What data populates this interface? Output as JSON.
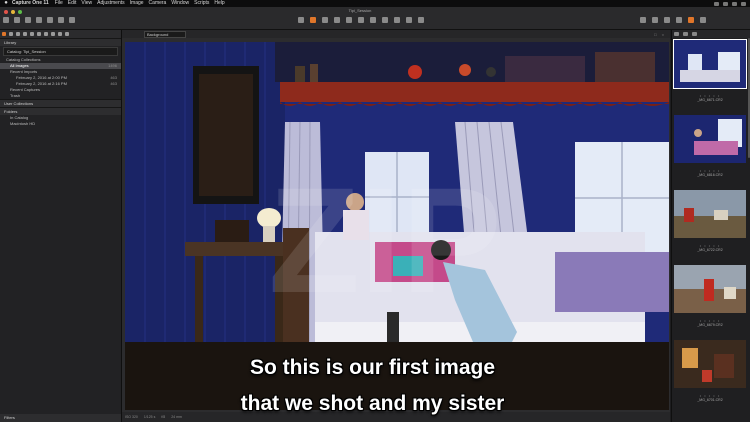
{
  "menubar": {
    "app_name": "Capture One 11",
    "items": [
      "File",
      "Edit",
      "View",
      "Adjustments",
      "Image",
      "Camera",
      "Window",
      "Scripts",
      "Help"
    ]
  },
  "window": {
    "title": "Tipi_Session"
  },
  "library": {
    "header": "Library",
    "dropdown": "Catalog: Tipi_Session",
    "catalog_collections": "Catalog Collections",
    "all_images": {
      "label": "All Images",
      "count": "1496"
    },
    "recent_imports": "Recent Imports",
    "imports": [
      {
        "label": "February 2, 2016 at 2:00 PM",
        "count": "463"
      },
      {
        "label": "February 2, 2016 at 2:16 PM",
        "count": "463"
      }
    ],
    "recent_captures": "Recent Captures",
    "trash": "Trash",
    "user_collections": "User Collections",
    "folders": "Folders",
    "in_catalog": "In Catalog",
    "macintosh_hd": "Macintosh HD",
    "footer": "Filters"
  },
  "viewer": {
    "layer": "Background",
    "status": [
      "ISO 320",
      "1/125 s",
      "f/8",
      "24 mm"
    ]
  },
  "browser": {
    "rating": "• • • • •",
    "thumbs": [
      {
        "name": "_MG_6671.CR2"
      },
      {
        "name": "_MG_6816.CR2"
      },
      {
        "name": "_MG_6722.CR2"
      },
      {
        "name": "_MG_6679.CR2"
      },
      {
        "name": "_MG_6701.CR2"
      }
    ]
  },
  "subtitle": {
    "line1": "So this is our first image",
    "line2": "that we shot and my sister"
  },
  "colors": {
    "accent": "#e0762a",
    "wall_blue": "#24318a",
    "shelf_red": "#9a2a1a"
  }
}
